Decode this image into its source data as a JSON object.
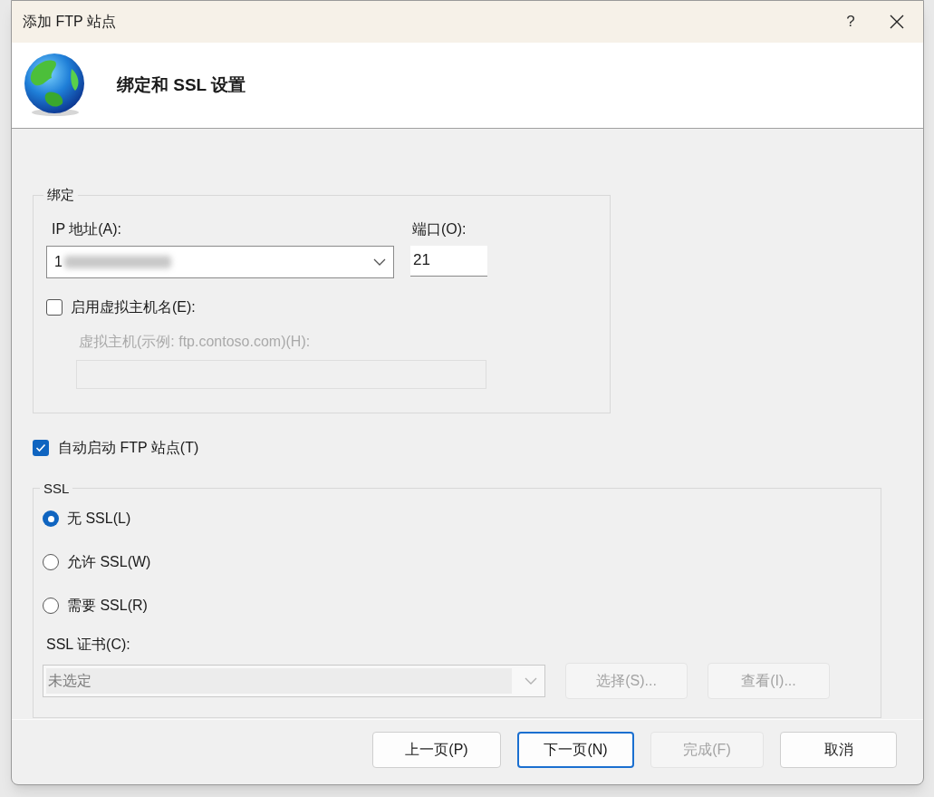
{
  "window": {
    "title": "添加 FTP 站点",
    "help": "?"
  },
  "header": {
    "title": "绑定和 SSL 设置"
  },
  "binding": {
    "legend": "绑定",
    "ip": {
      "label": "IP 地址(A):",
      "value": "1"
    },
    "port": {
      "label": "端口(O):",
      "value": "21"
    },
    "virtual_host": {
      "label": "启用虚拟主机名(E):",
      "checked": false
    },
    "host_field": {
      "label": "虚拟主机(示例: ftp.contoso.com)(H):",
      "disabled": true
    }
  },
  "auto_start": {
    "label": "自动启动 FTP 站点(T)",
    "checked": true
  },
  "ssl": {
    "legend": "SSL",
    "options": [
      {
        "label": "无 SSL(L)",
        "selected": true
      },
      {
        "label": "允许 SSL(W)",
        "selected": false
      },
      {
        "label": "需要 SSL(R)",
        "selected": false
      }
    ],
    "certificate": {
      "label": "SSL 证书(C):",
      "value": "未选定",
      "disabled": true
    },
    "buttons": [
      {
        "label": "选择(S)...",
        "disabled": true
      },
      {
        "label": "查看(I)...",
        "disabled": true
      }
    ]
  },
  "footer": {
    "buttons": [
      {
        "label": "上一页(P)",
        "disabled": false,
        "focused": false
      },
      {
        "label": "下一页(N)",
        "disabled": false,
        "focused": true
      },
      {
        "label": "完成(F)",
        "disabled": true,
        "focused": false
      },
      {
        "label": "取消",
        "disabled": false,
        "focused": false
      }
    ]
  }
}
